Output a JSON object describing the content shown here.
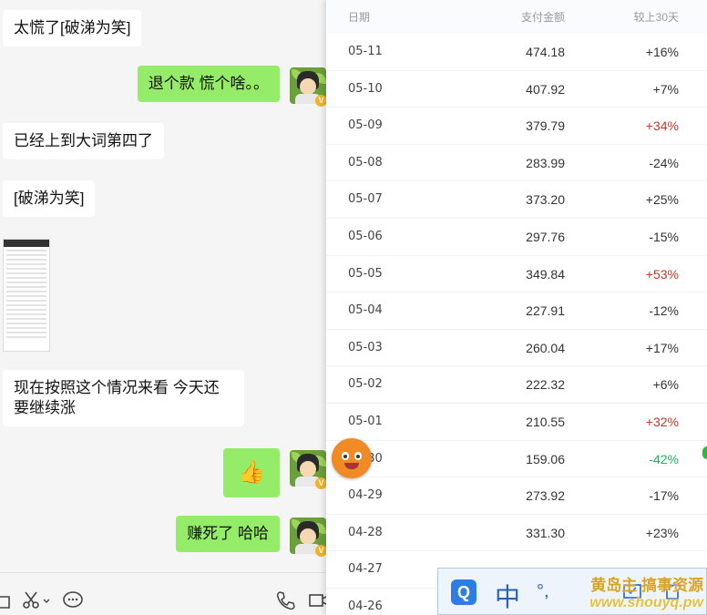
{
  "chat": {
    "messages": [
      {
        "side": "in",
        "text": "太慌了[破涕为笑]"
      },
      {
        "side": "out",
        "text": "退个款 慌个啥。。"
      },
      {
        "side": "in",
        "text": "已经上到大词第四了"
      },
      {
        "side": "in",
        "text": "[破涕为笑]"
      },
      {
        "side": "in",
        "text": "现在按照这个情况来看 今天还要继续涨"
      },
      {
        "side": "out",
        "text": "👍"
      },
      {
        "side": "out",
        "text": "赚死了  哈哈"
      }
    ],
    "avatar_badge": "V",
    "toolbar_icons": [
      "folder-icon",
      "scissors-icon",
      "chat-icon",
      "phone-icon",
      "video-icon"
    ]
  },
  "table": {
    "headers": {
      "date": "日期",
      "amount": "支付金额",
      "change": "较上30天"
    },
    "rows": [
      {
        "date": "05-11",
        "amount": "474.18",
        "change": "+16%",
        "tone": "neutral"
      },
      {
        "date": "05-10",
        "amount": "407.92",
        "change": "+7%",
        "tone": "neutral"
      },
      {
        "date": "05-09",
        "amount": "379.79",
        "change": "+34%",
        "tone": "up"
      },
      {
        "date": "05-08",
        "amount": "283.99",
        "change": "-24%",
        "tone": "neutral"
      },
      {
        "date": "05-07",
        "amount": "373.20",
        "change": "+25%",
        "tone": "neutral"
      },
      {
        "date": "05-06",
        "amount": "297.76",
        "change": "-15%",
        "tone": "neutral"
      },
      {
        "date": "05-05",
        "amount": "349.84",
        "change": "+53%",
        "tone": "up"
      },
      {
        "date": "05-04",
        "amount": "227.91",
        "change": "-12%",
        "tone": "neutral"
      },
      {
        "date": "05-03",
        "amount": "260.04",
        "change": "+17%",
        "tone": "neutral"
      },
      {
        "date": "05-02",
        "amount": "222.32",
        "change": "+6%",
        "tone": "neutral"
      },
      {
        "date": "05-01",
        "amount": "210.55",
        "change": "+32%",
        "tone": "up"
      },
      {
        "date": "04-30",
        "amount": "159.06",
        "change": "-42%",
        "tone": "down"
      },
      {
        "date": "04-29",
        "amount": "273.92",
        "change": "-17%",
        "tone": "neutral"
      },
      {
        "date": "04-28",
        "amount": "331.30",
        "change": "+23%",
        "tone": "neutral"
      },
      {
        "date": "04-27",
        "amount": "",
        "change": "",
        "tone": "neutral"
      },
      {
        "date": "04-26",
        "amount": "",
        "change": "",
        "tone": "neutral"
      }
    ]
  },
  "ime": {
    "q_label": "Q",
    "mode_label": "中",
    "extra": "°,"
  },
  "watermark": {
    "line1": "黄岛主 搞事资源",
    "line2": "www.shouyq.pw"
  },
  "colors": {
    "chat_out": "#95ec69",
    "up": "#c0392b",
    "down": "#27ae60"
  }
}
